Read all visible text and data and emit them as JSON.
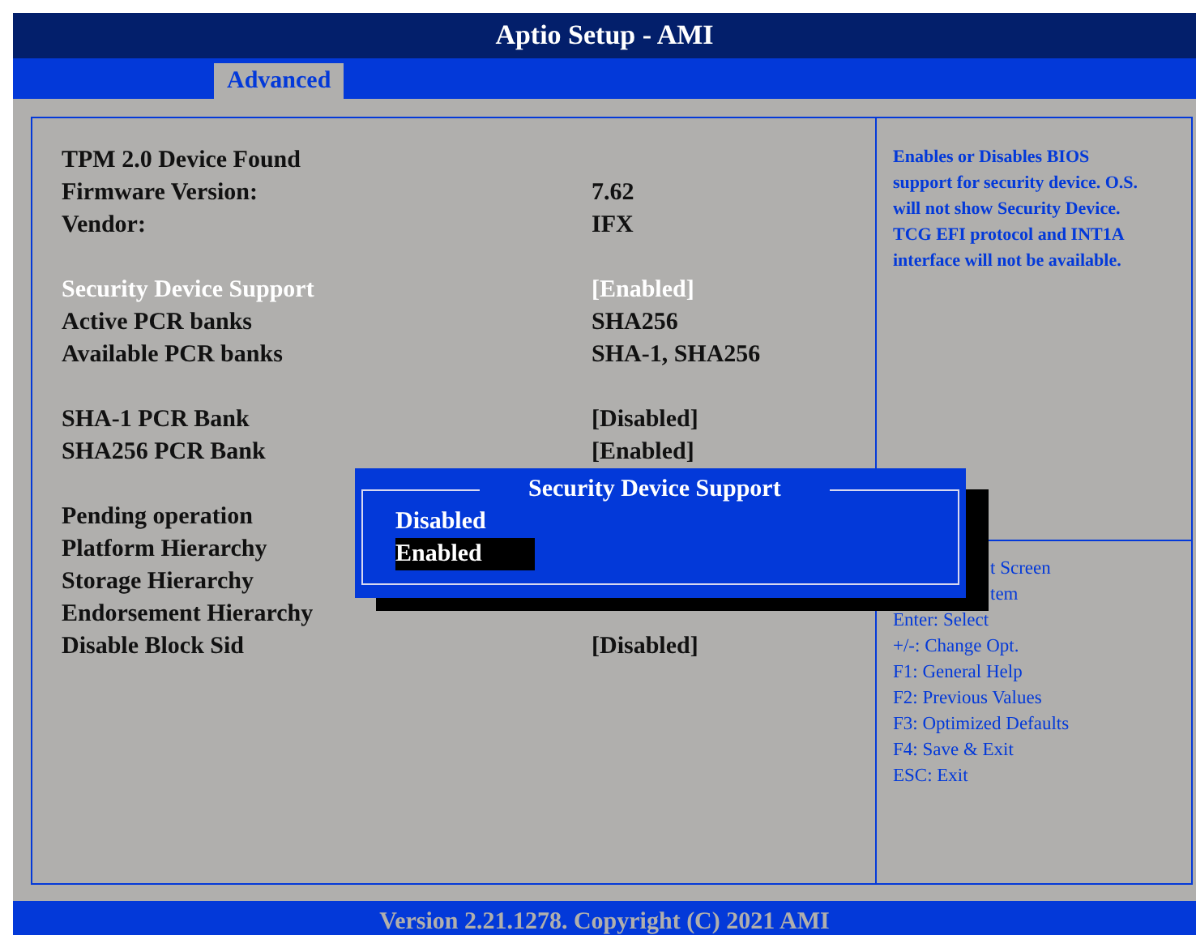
{
  "title": "Aptio Setup - AMI",
  "tabs": [
    {
      "label": "Advanced",
      "selected": true
    }
  ],
  "groups": [
    [
      {
        "label": "TPM 2.0 Device Found",
        "selected": false
      },
      {
        "label": "Firmware Version:",
        "value": "7.62",
        "selected": false
      },
      {
        "label": "Vendor:",
        "value": "IFX",
        "selected": false
      }
    ],
    [
      {
        "label": "Security Device Support",
        "value": "[Enabled]",
        "selected": true
      },
      {
        "label": "Active PCR banks",
        "value": "SHA256",
        "selected": false
      },
      {
        "label": "Available PCR banks",
        "value": "SHA-1, SHA256",
        "selected": false
      }
    ],
    [
      {
        "label": "SHA-1 PCR Bank",
        "value": "[Disabled]",
        "selected": false
      },
      {
        "label": "SHA256 PCR Bank",
        "value": "[Enabled]",
        "selected": false
      }
    ],
    [
      {
        "label": "Pending operation",
        "selected": false
      },
      {
        "label": "Platform Hierarchy",
        "selected": false
      },
      {
        "label": "Storage Hierarchy",
        "selected": false
      },
      {
        "label": "Endorsement Hierarchy",
        "selected": false
      },
      {
        "label": "Disable Block Sid",
        "value": "[Disabled]",
        "selected": false
      }
    ]
  ],
  "help": "Enables or Disables BIOS support for security device. O.S. will not show Security Device. TCG EFI protocol and INT1A interface will not be available.",
  "keys": [
    {
      "text": "t Screen",
      "kind": "covered"
    },
    {
      "text": "tem",
      "kind": "covered"
    },
    {
      "text": "Enter: Select",
      "kind": "plain"
    },
    {
      "text": "+/-: Change Opt.",
      "kind": "plain"
    },
    {
      "text": "F1: General Help",
      "kind": "plain"
    },
    {
      "text": "F2: Previous Values",
      "kind": "plain"
    },
    {
      "text": "F3: Optimized Defaults",
      "kind": "plain"
    },
    {
      "text": "F4: Save & Exit",
      "kind": "plain"
    },
    {
      "text": "ESC: Exit",
      "kind": "plain"
    }
  ],
  "dialog": {
    "title": "Security Device Support",
    "options": [
      {
        "label": "Disabled",
        "selected": false
      },
      {
        "label": "Enabled",
        "selected": true
      }
    ]
  },
  "footer": "Version 2.21.1278. Copyright (C) 2021 AMI"
}
